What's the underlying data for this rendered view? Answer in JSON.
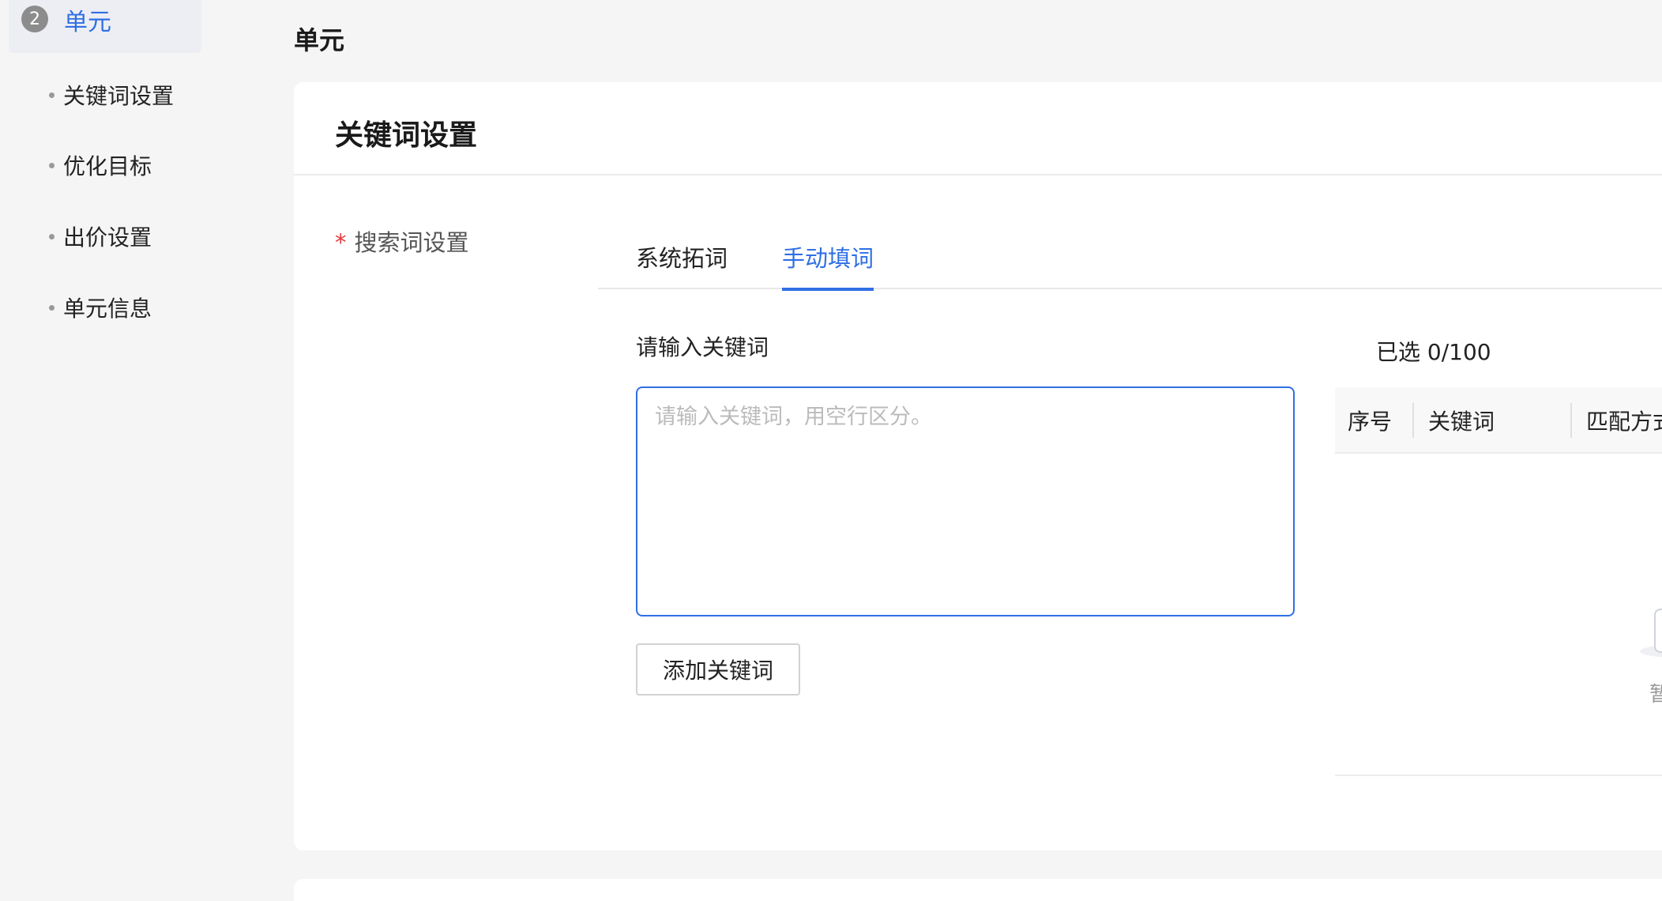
{
  "sidebar": {
    "step": {
      "number": "2",
      "label": "单元"
    },
    "items": [
      {
        "label": "关键词设置"
      },
      {
        "label": "优化目标"
      },
      {
        "label": "出价设置"
      },
      {
        "label": "单元信息"
      }
    ]
  },
  "main": {
    "section_title": "单元",
    "card": {
      "title": "关键词设置",
      "field_label": "搜索词设置",
      "required_mark": "*",
      "tabs": [
        {
          "label": "系统拓词",
          "active": false
        },
        {
          "label": "手动填词",
          "active": true
        }
      ],
      "keyword_input": {
        "label": "请输入关键词",
        "placeholder": "请输入关键词，用空行区分。",
        "value": ""
      },
      "add_button": "添加关键词",
      "selected": {
        "count_text": "已选 0/100",
        "columns": [
          "序号",
          "关键词",
          "匹配方式"
        ],
        "empty_text": "暂无数据"
      }
    }
  },
  "colors": {
    "accent": "#2f6fe4",
    "required": "#e4393c",
    "background": "#f5f5f5"
  }
}
